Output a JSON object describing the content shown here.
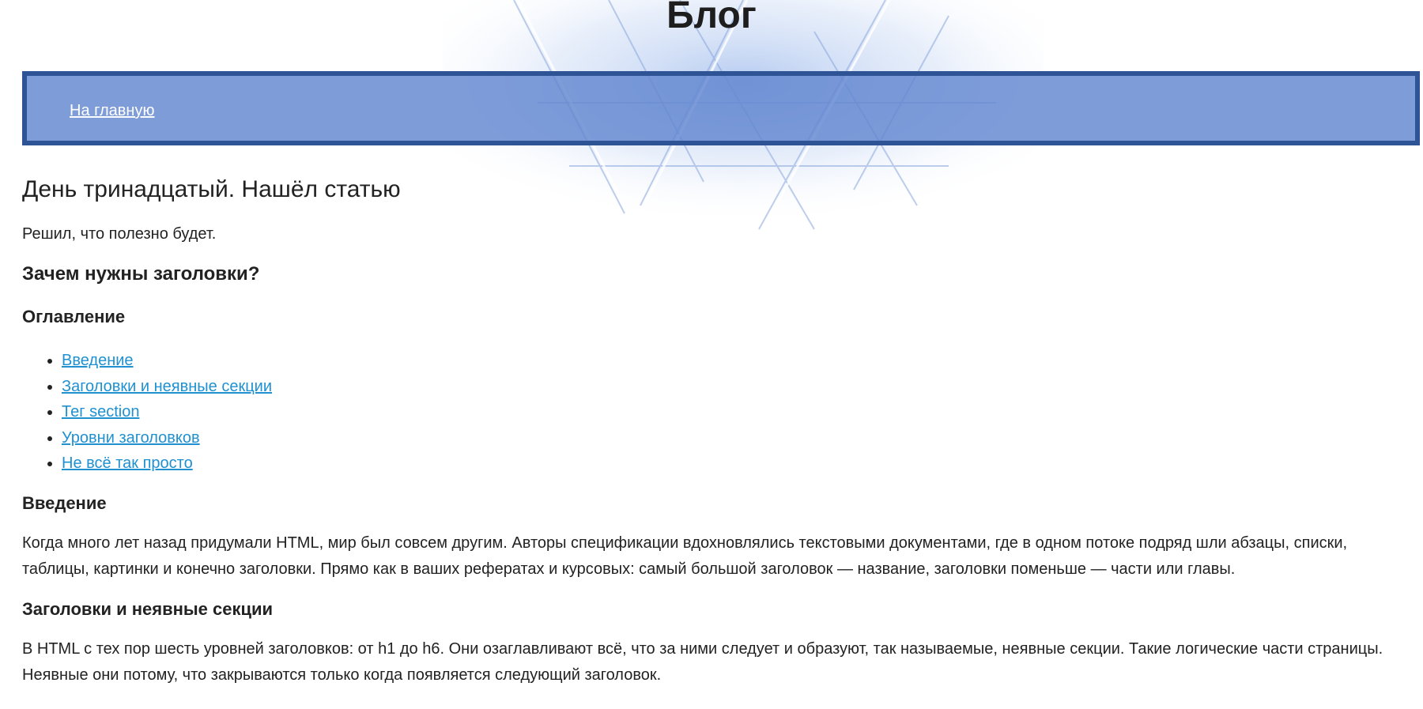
{
  "header": {
    "site_title": "Блог"
  },
  "nav": {
    "home_link": "На главную"
  },
  "post": {
    "title": "День тринадцатый. Нашёл статью",
    "intro": "Решил, что полезно будет."
  },
  "article": {
    "title": "Зачем нужны заголовки?",
    "toc_title": "Оглавление",
    "toc": [
      "Введение",
      "Заголовки и неявные секции",
      "Тег section",
      "Уровни заголовков",
      "Не всё так просто"
    ],
    "sections": [
      {
        "title": "Введение",
        "text": "Когда много лет назад придумали HTML, мир был совсем другим. Авторы спецификации вдохновлялись текстовыми документами, где в одном потоке подряд шли абзацы, списки, таблицы, картинки и конечно заголовки. Прямо как в ваших рефератах и курсовых: самый большой заголовок — название, заголовки поменьше — части или главы."
      },
      {
        "title": "Заголовки и неявные секции",
        "text": "В HTML с тех пор шесть уровней заголовков: от h1 до h6. Они озаглавливают всё, что за ними следует и образуют, так называемые, неявные секции. Такие логические части страницы. Неявные они потому, что закрываются только когда появляется следующий заголовок."
      }
    ]
  },
  "colors": {
    "nav_background": "#6f8fd3",
    "nav_border": "#2f5496",
    "link": "#1f91d0",
    "text": "#222222"
  }
}
